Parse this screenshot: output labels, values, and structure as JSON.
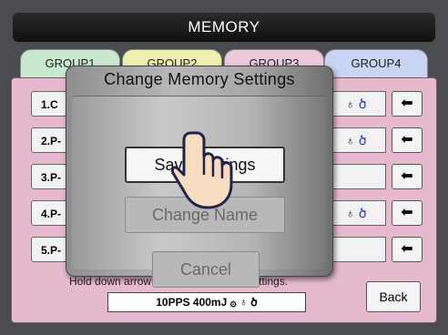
{
  "header": {
    "title": "MEMORY"
  },
  "tabs": [
    {
      "label": "GROUP1"
    },
    {
      "label": "GROUP2"
    },
    {
      "label": "GROUP3"
    },
    {
      "label": "GROUP4"
    }
  ],
  "presets": [
    {
      "label": "1.C"
    },
    {
      "label": "2.P-"
    },
    {
      "label": "3.P-"
    },
    {
      "label": "4.P-"
    },
    {
      "label": "5.P-"
    }
  ],
  "row_icons": {
    "icon1": "♁",
    "icon2": "ㄣ",
    "icon3": "ծ"
  },
  "arrow_glyph": "⬅",
  "hint": {
    "text": "Hold down arrow ⬅ to save memory settings."
  },
  "status": {
    "text": "10PPS 400mJ ۞ ♁ ծ"
  },
  "back_button": {
    "label": "Back"
  },
  "dialog": {
    "title": "Change Memory Settings",
    "save_label": "Save Settings",
    "change_name_label": "Change Name",
    "cancel_label": "Cancel"
  },
  "colors": {
    "panel": "#e7b9cf",
    "group1": "#c8e8cf",
    "group2": "#eef0b0",
    "group3": "#ecc9dd",
    "group4": "#c9d3f2",
    "accent_blue": "#1f3ec4"
  },
  "icons": [
    "hand-pointer-icon",
    "left-arrow-icon"
  ]
}
